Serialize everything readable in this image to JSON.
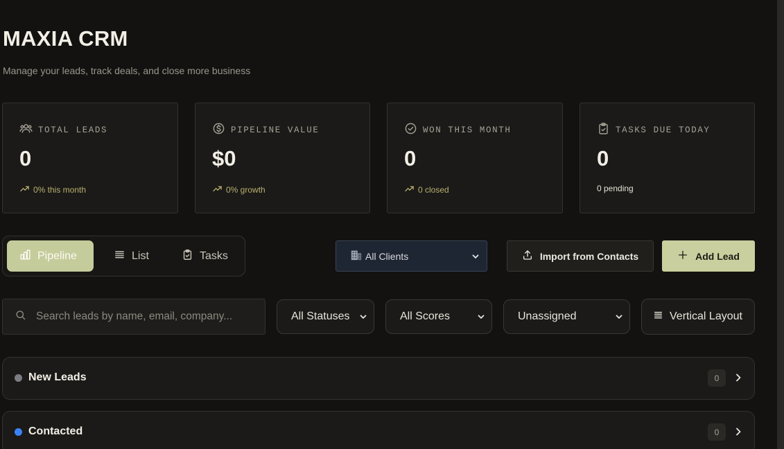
{
  "header": {
    "title": "MAXIA CRM",
    "subtitle": "Manage your leads, track deals, and close more business"
  },
  "stats": [
    {
      "icon": "users-icon",
      "label": "TOTAL LEADS",
      "value": "0",
      "foot": "0% this month",
      "trend": true
    },
    {
      "icon": "dollar-circle-icon",
      "label": "PIPELINE VALUE",
      "value": "$0",
      "foot": "0% growth",
      "trend": true
    },
    {
      "icon": "check-circle-icon",
      "label": "WON THIS MONTH",
      "value": "0",
      "foot": "0 closed",
      "trend": true
    },
    {
      "icon": "clipboard-check-icon",
      "label": "TASKS DUE TODAY",
      "value": "0",
      "foot": "0 pending",
      "trend": false
    }
  ],
  "views": {
    "pipeline": "Pipeline",
    "list": "List",
    "tasks": "Tasks",
    "active": "pipeline"
  },
  "toolbar": {
    "client_select": {
      "icon": "building-icon",
      "value": "All Clients"
    },
    "import_label": "Import from Contacts",
    "add_label": "Add Lead"
  },
  "filters": {
    "search_placeholder": "Search leads by name, email, company...",
    "status": "All Statuses",
    "score": "All Scores",
    "assignee": "Unassigned",
    "layout_label": "Vertical Layout"
  },
  "stages": [
    {
      "name": "New Leads",
      "count": "0",
      "color": "#7a7d83"
    },
    {
      "name": "Contacted",
      "count": "0",
      "color": "#3b82f6"
    }
  ],
  "colors": {
    "background": "#131211",
    "accent": "#c9cf9e",
    "trend": "#b8b06f"
  }
}
